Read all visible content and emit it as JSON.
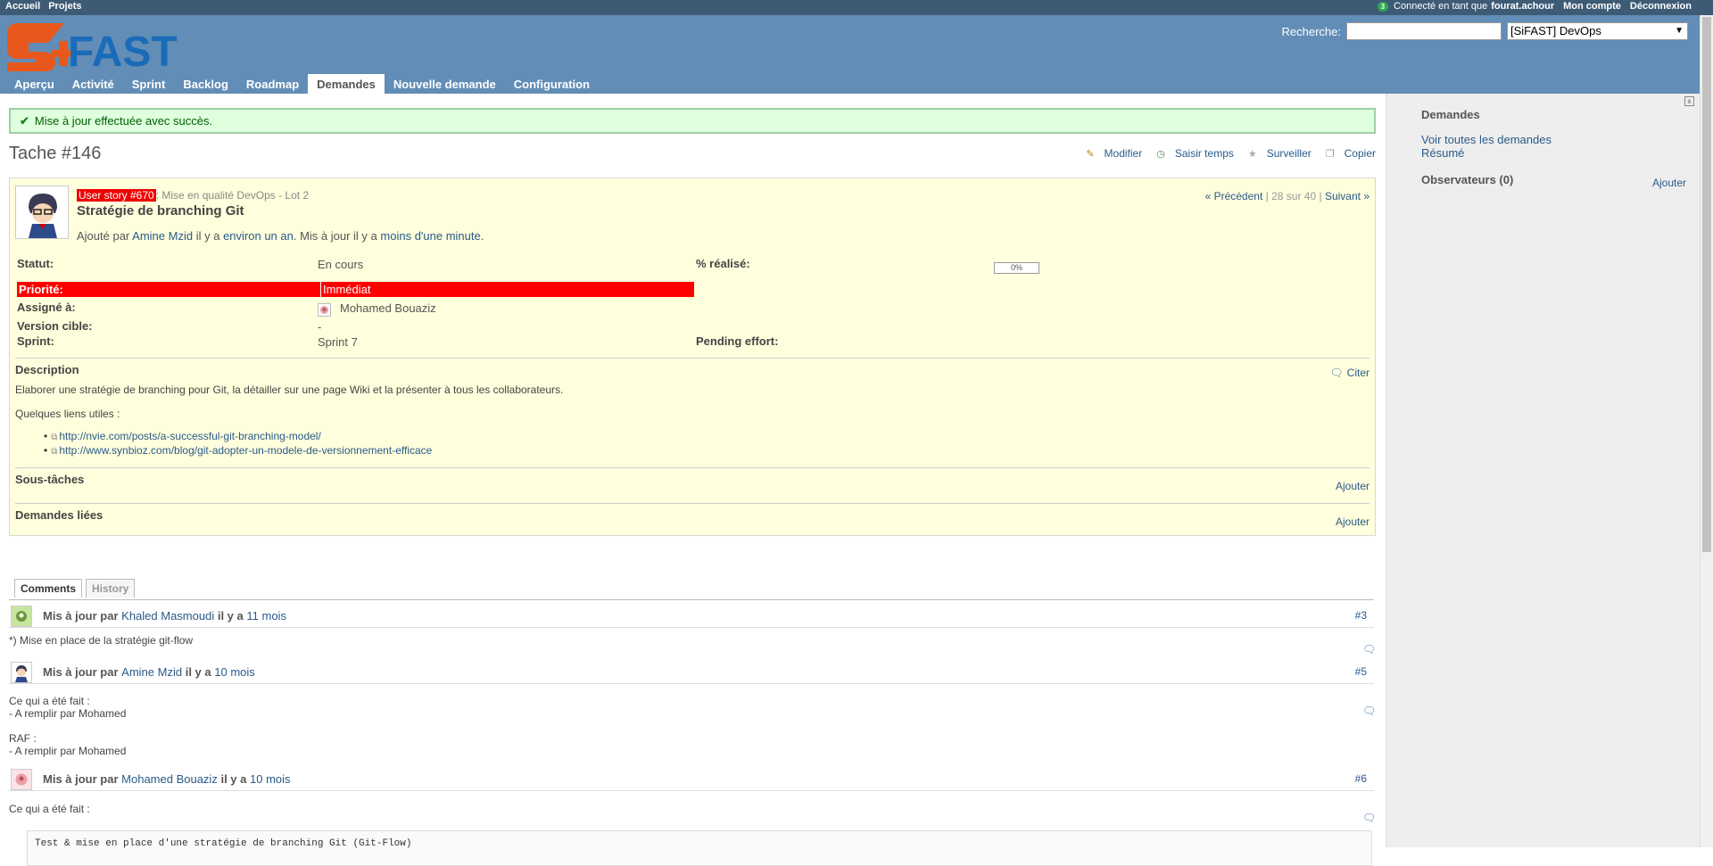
{
  "top_menu": {
    "home": "Accueil",
    "projects": "Projets",
    "badge": "3",
    "logged_prefix": "Connecté en tant que",
    "user": "fourat.achour",
    "account": "Mon compte",
    "logout": "Déconnexion"
  },
  "header": {
    "logo_text": "FAST",
    "search_label": "Recherche:",
    "search_value": "",
    "project_selected": "[SiFAST] DevOps"
  },
  "main_menu": [
    "Aperçu",
    "Activité",
    "Sprint",
    "Backlog",
    "Roadmap",
    "Demandes",
    "Nouvelle demande",
    "Configuration"
  ],
  "flash": "Mise à jour effectuée avec succès.",
  "issue": {
    "title": "Tache #146",
    "actions": {
      "edit": "Modifier",
      "log_time": "Saisir temps",
      "watch": "Surveiller",
      "copy": "Copier"
    },
    "parent_tag": "User story #670",
    "parent_rest": ": Mise en qualité DevOps - Lot 2",
    "subject": "Stratégie de branching Git",
    "nav": {
      "prev": "« Précédent",
      "count": "28 sur 40",
      "next": "Suivant »",
      "sep": "|"
    },
    "author": {
      "added_by": "Ajouté par",
      "author_name": "Amine Mzid",
      "ago1_prefix": "il y a",
      "ago1": "environ un an",
      "updated": ". Mis à jour il y a",
      "ago2": "moins d'une minute",
      "end": "."
    },
    "attributes": {
      "status_label": "Statut:",
      "status_value": "En cours",
      "done_label": "% réalisé:",
      "done_value": "0%",
      "done_fraction": 0,
      "priority_label": "Priorité:",
      "priority_value": "Immédiat",
      "assignee_label": "Assigné à:",
      "assignee_value": "Mohamed Bouaziz",
      "version_label": "Version cible:",
      "version_value": "-",
      "sprint_label": "Sprint:",
      "sprint_value": "Sprint 7",
      "pending_label": "Pending effort:"
    },
    "description": {
      "title": "Description",
      "quote": "Citer",
      "text": "Elaborer une stratégie de branching pour Git, la détailler sur une page Wiki et la présenter à tous les collaborateurs.",
      "links_intro": "Quelques liens utiles :",
      "links": [
        "http://nvie.com/posts/a-successful-git-branching-model/",
        "http://www.synbioz.com/blog/git-adopter-un-modele-de-versionnement-efficace"
      ]
    },
    "subtasks": {
      "title": "Sous-tâches",
      "add": "Ajouter"
    },
    "relations": {
      "title": "Demandes liées",
      "add": "Ajouter"
    }
  },
  "history_tabs": {
    "comments": "Comments",
    "history": "History"
  },
  "journals": [
    {
      "by": "Mis à jour par",
      "user": "Khaled Masmoudi",
      "ago_prefix": "il y a",
      "ago": "11 mois",
      "num": "#3",
      "lines": [
        "*) Mise en place de la stratégie git-flow"
      ]
    },
    {
      "by": "Mis à jour par",
      "user": "Amine Mzid",
      "ago_prefix": "il y a",
      "ago": "10 mois",
      "num": "#5",
      "lines": [
        "Ce qui a été fait :",
        "- A remplir par Mohamed",
        "RAF :",
        "- A remplir par Mohamed"
      ]
    },
    {
      "by": "Mis à jour par",
      "user": "Mohamed Bouaziz",
      "ago_prefix": "il y a",
      "ago": "10 mois",
      "num": "#6",
      "lines": [
        "Ce qui a été fait :"
      ],
      "code": "Test & mise en place d'une stratégie de branching Git (Git-Flow)"
    }
  ],
  "sidebar": {
    "title": "Demandes",
    "all_issues": "Voir toutes les demandes",
    "summary": "Résumé",
    "watchers": "Observateurs (0)",
    "add": "Ajouter",
    "close": "x"
  }
}
